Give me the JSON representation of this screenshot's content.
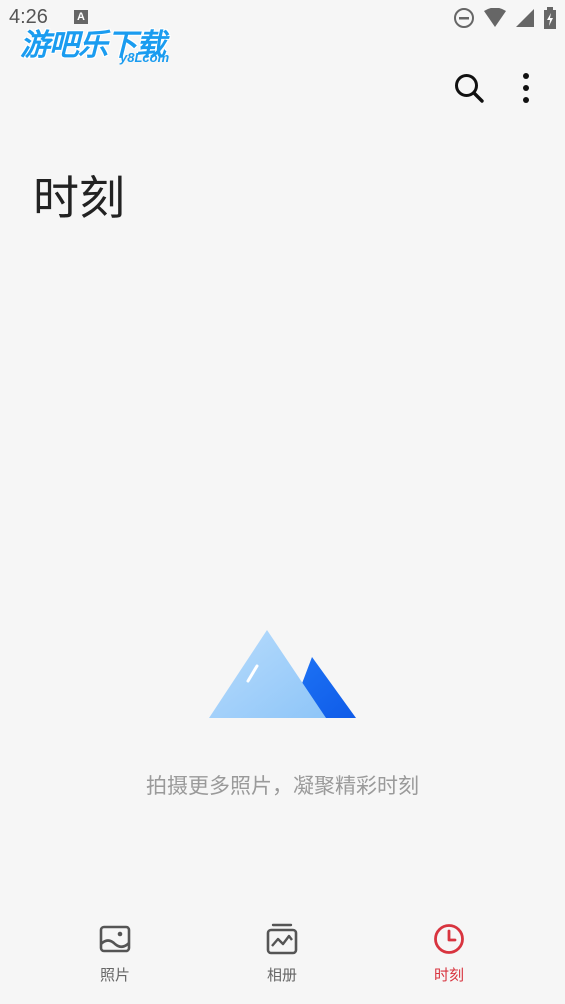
{
  "status_bar": {
    "time": "4:26",
    "notification_badge": "A"
  },
  "watermark": {
    "main": "游吧乐下载",
    "sub": "y8Lcom"
  },
  "header": {
    "title": "时刻"
  },
  "empty_state": {
    "message": "拍摄更多照片，凝聚精彩时刻"
  },
  "bottom_nav": {
    "items": [
      {
        "label": "照片",
        "icon": "photo-icon",
        "active": false
      },
      {
        "label": "相册",
        "icon": "album-icon",
        "active": false
      },
      {
        "label": "时刻",
        "icon": "clock-icon",
        "active": true
      }
    ]
  },
  "colors": {
    "accent": "#d8343f",
    "background": "#f6f6f6",
    "illustration_light": "#a9d4fb",
    "illustration_dark": "#1565f2"
  }
}
